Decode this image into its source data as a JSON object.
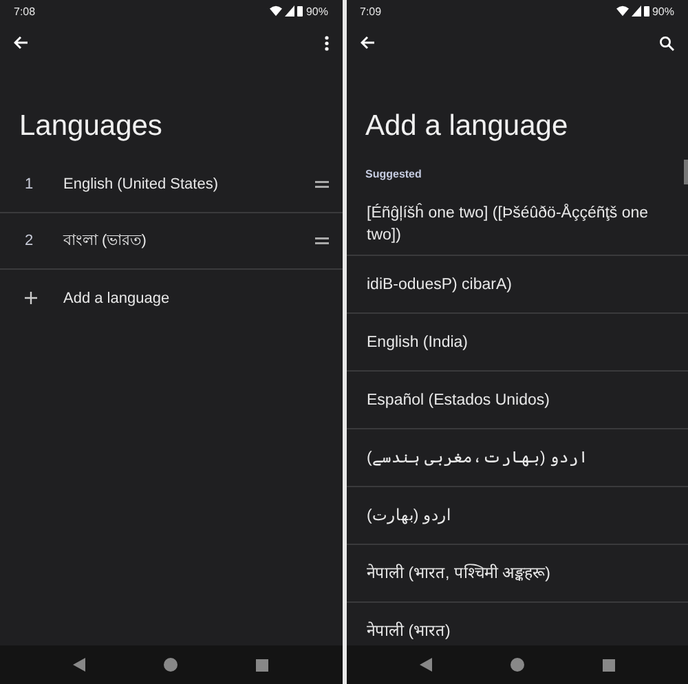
{
  "screens": [
    {
      "status_bar": {
        "time": "7:08",
        "battery": "90%"
      },
      "toolbar": {
        "kind": "more"
      },
      "title": "Languages",
      "rows": [
        {
          "kind": "language",
          "number": "1",
          "name": "English (United States)"
        },
        {
          "kind": "language",
          "number": "2",
          "name": "বাংলা (ভারত)"
        },
        {
          "kind": "add",
          "name": "Add a language"
        }
      ]
    },
    {
      "status_bar": {
        "time": "7:09",
        "battery": "90%"
      },
      "toolbar": {
        "kind": "search"
      },
      "title": "Add a language",
      "section": "Suggested",
      "rows": [
        {
          "kind": "option",
          "name": "[Éñĝļíšĥ one two] ([Þšéûðö-Åççéñţš one two])"
        },
        {
          "kind": "option",
          "name": "idiB-oduesP) cibarA)"
        },
        {
          "kind": "option",
          "name": "English (India)"
        },
        {
          "kind": "option",
          "name": "Español (Estados Unidos)"
        },
        {
          "kind": "option",
          "name": "اردو (بھارت،مغربی ہندسے)"
        },
        {
          "kind": "option",
          "name": "اردو (بھارت)"
        },
        {
          "kind": "option",
          "name": "नेपाली (भारत, पश्चिमी अङ्कहरू)"
        },
        {
          "kind": "option",
          "name": "नेपाली (भारत)"
        }
      ]
    }
  ]
}
